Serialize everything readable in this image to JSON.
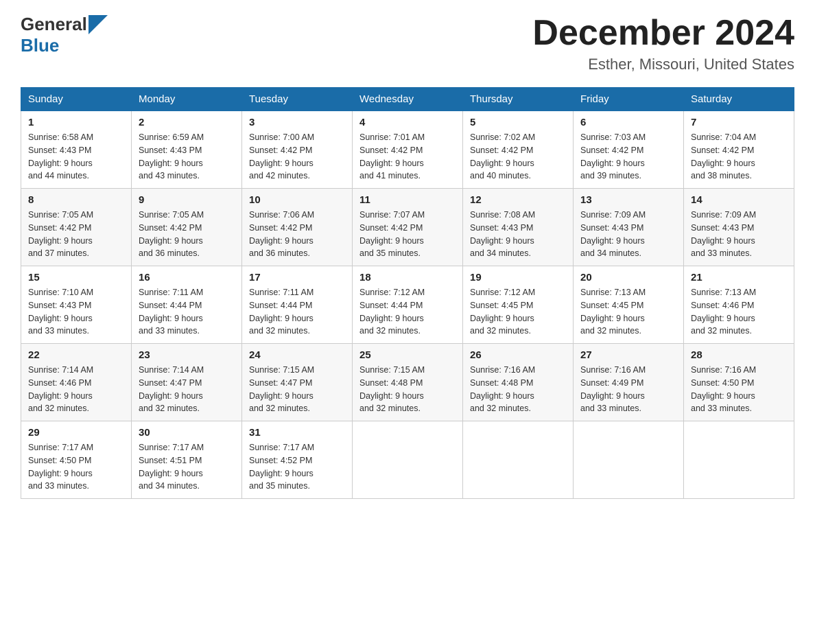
{
  "logo": {
    "general": "General",
    "blue": "Blue"
  },
  "header": {
    "month": "December 2024",
    "location": "Esther, Missouri, United States"
  },
  "weekdays": [
    "Sunday",
    "Monday",
    "Tuesday",
    "Wednesday",
    "Thursday",
    "Friday",
    "Saturday"
  ],
  "weeks": [
    [
      {
        "day": "1",
        "sunrise": "6:58 AM",
        "sunset": "4:43 PM",
        "daylight": "9 hours and 44 minutes."
      },
      {
        "day": "2",
        "sunrise": "6:59 AM",
        "sunset": "4:43 PM",
        "daylight": "9 hours and 43 minutes."
      },
      {
        "day": "3",
        "sunrise": "7:00 AM",
        "sunset": "4:42 PM",
        "daylight": "9 hours and 42 minutes."
      },
      {
        "day": "4",
        "sunrise": "7:01 AM",
        "sunset": "4:42 PM",
        "daylight": "9 hours and 41 minutes."
      },
      {
        "day": "5",
        "sunrise": "7:02 AM",
        "sunset": "4:42 PM",
        "daylight": "9 hours and 40 minutes."
      },
      {
        "day": "6",
        "sunrise": "7:03 AM",
        "sunset": "4:42 PM",
        "daylight": "9 hours and 39 minutes."
      },
      {
        "day": "7",
        "sunrise": "7:04 AM",
        "sunset": "4:42 PM",
        "daylight": "9 hours and 38 minutes."
      }
    ],
    [
      {
        "day": "8",
        "sunrise": "7:05 AM",
        "sunset": "4:42 PM",
        "daylight": "9 hours and 37 minutes."
      },
      {
        "day": "9",
        "sunrise": "7:05 AM",
        "sunset": "4:42 PM",
        "daylight": "9 hours and 36 minutes."
      },
      {
        "day": "10",
        "sunrise": "7:06 AM",
        "sunset": "4:42 PM",
        "daylight": "9 hours and 36 minutes."
      },
      {
        "day": "11",
        "sunrise": "7:07 AM",
        "sunset": "4:42 PM",
        "daylight": "9 hours and 35 minutes."
      },
      {
        "day": "12",
        "sunrise": "7:08 AM",
        "sunset": "4:43 PM",
        "daylight": "9 hours and 34 minutes."
      },
      {
        "day": "13",
        "sunrise": "7:09 AM",
        "sunset": "4:43 PM",
        "daylight": "9 hours and 34 minutes."
      },
      {
        "day": "14",
        "sunrise": "7:09 AM",
        "sunset": "4:43 PM",
        "daylight": "9 hours and 33 minutes."
      }
    ],
    [
      {
        "day": "15",
        "sunrise": "7:10 AM",
        "sunset": "4:43 PM",
        "daylight": "9 hours and 33 minutes."
      },
      {
        "day": "16",
        "sunrise": "7:11 AM",
        "sunset": "4:44 PM",
        "daylight": "9 hours and 33 minutes."
      },
      {
        "day": "17",
        "sunrise": "7:11 AM",
        "sunset": "4:44 PM",
        "daylight": "9 hours and 32 minutes."
      },
      {
        "day": "18",
        "sunrise": "7:12 AM",
        "sunset": "4:44 PM",
        "daylight": "9 hours and 32 minutes."
      },
      {
        "day": "19",
        "sunrise": "7:12 AM",
        "sunset": "4:45 PM",
        "daylight": "9 hours and 32 minutes."
      },
      {
        "day": "20",
        "sunrise": "7:13 AM",
        "sunset": "4:45 PM",
        "daylight": "9 hours and 32 minutes."
      },
      {
        "day": "21",
        "sunrise": "7:13 AM",
        "sunset": "4:46 PM",
        "daylight": "9 hours and 32 minutes."
      }
    ],
    [
      {
        "day": "22",
        "sunrise": "7:14 AM",
        "sunset": "4:46 PM",
        "daylight": "9 hours and 32 minutes."
      },
      {
        "day": "23",
        "sunrise": "7:14 AM",
        "sunset": "4:47 PM",
        "daylight": "9 hours and 32 minutes."
      },
      {
        "day": "24",
        "sunrise": "7:15 AM",
        "sunset": "4:47 PM",
        "daylight": "9 hours and 32 minutes."
      },
      {
        "day": "25",
        "sunrise": "7:15 AM",
        "sunset": "4:48 PM",
        "daylight": "9 hours and 32 minutes."
      },
      {
        "day": "26",
        "sunrise": "7:16 AM",
        "sunset": "4:48 PM",
        "daylight": "9 hours and 32 minutes."
      },
      {
        "day": "27",
        "sunrise": "7:16 AM",
        "sunset": "4:49 PM",
        "daylight": "9 hours and 33 minutes."
      },
      {
        "day": "28",
        "sunrise": "7:16 AM",
        "sunset": "4:50 PM",
        "daylight": "9 hours and 33 minutes."
      }
    ],
    [
      {
        "day": "29",
        "sunrise": "7:17 AM",
        "sunset": "4:50 PM",
        "daylight": "9 hours and 33 minutes."
      },
      {
        "day": "30",
        "sunrise": "7:17 AM",
        "sunset": "4:51 PM",
        "daylight": "9 hours and 34 minutes."
      },
      {
        "day": "31",
        "sunrise": "7:17 AM",
        "sunset": "4:52 PM",
        "daylight": "9 hours and 35 minutes."
      },
      null,
      null,
      null,
      null
    ]
  ],
  "labels": {
    "sunrise": "Sunrise: ",
    "sunset": "Sunset: ",
    "daylight": "Daylight: "
  }
}
